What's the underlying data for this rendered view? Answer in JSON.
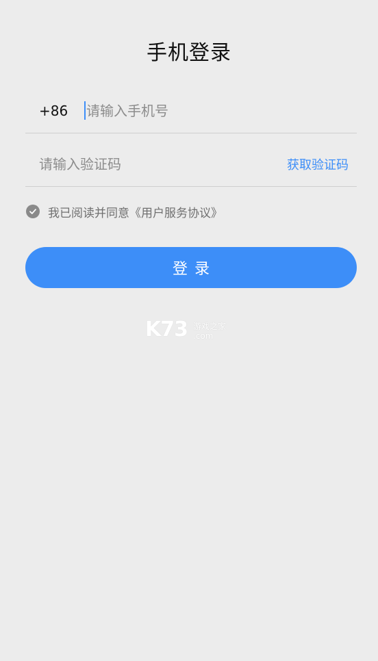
{
  "page": {
    "title": "手机登录"
  },
  "phone": {
    "country_code": "+86",
    "placeholder": "请输入手机号",
    "value": ""
  },
  "code": {
    "placeholder": "请输入验证码",
    "value": "",
    "get_code_label": "获取验证码"
  },
  "agreement": {
    "checked": true,
    "text": "我已阅读并同意《用户服务协议》",
    "icon": "check-circle-icon"
  },
  "login": {
    "label": "登录"
  },
  "watermark": {
    "main": "K73",
    "sub": "游戏之家",
    "domain": ".com"
  },
  "colors": {
    "accent": "#3d8ef8",
    "background": "#ececec",
    "checkbox": "#8a8a8a"
  }
}
